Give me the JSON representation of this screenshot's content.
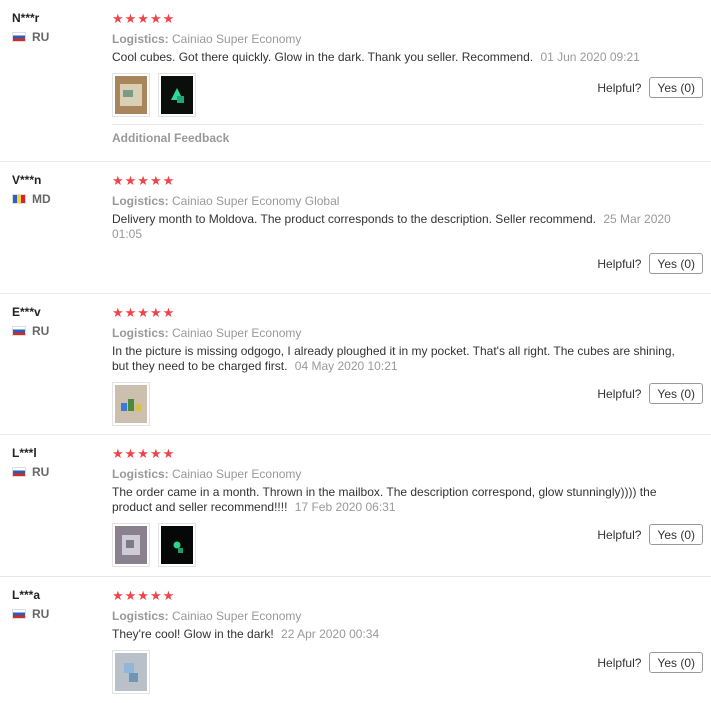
{
  "reviews": [
    {
      "user": "N***r",
      "country": "RU",
      "stars": "★★★★★",
      "logistics_label": "Logistics:",
      "logistics": "Cainiao Super Economy",
      "text": "Cool cubes. Got there quickly. Glow in the dark. Thank you seller. Recommend.",
      "date": "01 Jun 2020 09:21",
      "helpful_label": "Helpful?",
      "yes_label": "Yes (0)",
      "additional": "Additional Feedback"
    },
    {
      "user": "V***n",
      "country": "MD",
      "stars": "★★★★★",
      "logistics_label": "Logistics:",
      "logistics": "Cainiao Super Economy Global",
      "text": "Delivery month to Moldova. The product corresponds to the description. Seller recommend.",
      "date": "25 Mar 2020 01:05",
      "helpful_label": "Helpful?",
      "yes_label": "Yes (0)"
    },
    {
      "user": "E***v",
      "country": "RU",
      "stars": "★★★★★",
      "logistics_label": "Logistics:",
      "logistics": "Cainiao Super Economy",
      "text": "In the picture is missing odgogo, I already ploughed it in my pocket. That's all right. The cubes are shining, but they need to be charged first.",
      "date": "04 May 2020 10:21",
      "helpful_label": "Helpful?",
      "yes_label": "Yes (0)"
    },
    {
      "user": "L***l",
      "country": "RU",
      "stars": "★★★★★",
      "logistics_label": "Logistics:",
      "logistics": "Cainiao Super Economy",
      "text": "The order came in a month. Thrown in the mailbox. The description correspond, glow stunningly)))) the product and seller recommend!!!!",
      "date": "17 Feb 2020 06:31",
      "helpful_label": "Helpful?",
      "yes_label": "Yes (0)"
    },
    {
      "user": "L***a",
      "country": "RU",
      "stars": "★★★★★",
      "logistics_label": "Logistics:",
      "logistics": "Cainiao Super Economy",
      "text": "They're cool! Glow in the dark!",
      "date": "22 Apr 2020 00:34",
      "helpful_label": "Helpful?",
      "yes_label": "Yes (0)"
    }
  ]
}
